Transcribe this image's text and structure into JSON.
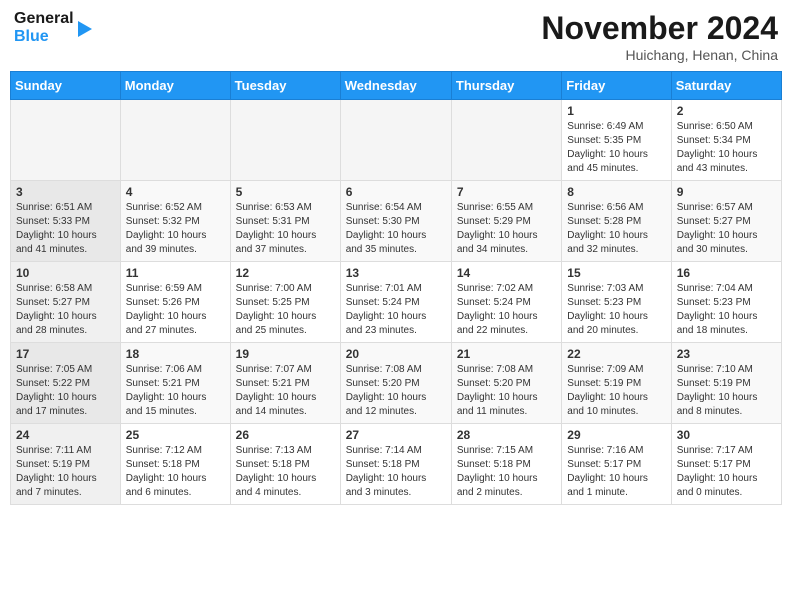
{
  "header": {
    "logo": {
      "general": "General",
      "blue": "Blue",
      "aria": "GeneralBlue logo"
    },
    "title": "November 2024",
    "location": "Huichang, Henan, China"
  },
  "calendar": {
    "days_of_week": [
      "Sunday",
      "Monday",
      "Tuesday",
      "Wednesday",
      "Thursday",
      "Friday",
      "Saturday"
    ],
    "weeks": [
      {
        "days": [
          {
            "num": "",
            "info": ""
          },
          {
            "num": "",
            "info": ""
          },
          {
            "num": "",
            "info": ""
          },
          {
            "num": "",
            "info": ""
          },
          {
            "num": "",
            "info": ""
          },
          {
            "num": "1",
            "info": "Sunrise: 6:49 AM\nSunset: 5:35 PM\nDaylight: 10 hours\nand 45 minutes."
          },
          {
            "num": "2",
            "info": "Sunrise: 6:50 AM\nSunset: 5:34 PM\nDaylight: 10 hours\nand 43 minutes."
          }
        ]
      },
      {
        "days": [
          {
            "num": "3",
            "info": "Sunrise: 6:51 AM\nSunset: 5:33 PM\nDaylight: 10 hours\nand 41 minutes."
          },
          {
            "num": "4",
            "info": "Sunrise: 6:52 AM\nSunset: 5:32 PM\nDaylight: 10 hours\nand 39 minutes."
          },
          {
            "num": "5",
            "info": "Sunrise: 6:53 AM\nSunset: 5:31 PM\nDaylight: 10 hours\nand 37 minutes."
          },
          {
            "num": "6",
            "info": "Sunrise: 6:54 AM\nSunset: 5:30 PM\nDaylight: 10 hours\nand 35 minutes."
          },
          {
            "num": "7",
            "info": "Sunrise: 6:55 AM\nSunset: 5:29 PM\nDaylight: 10 hours\nand 34 minutes."
          },
          {
            "num": "8",
            "info": "Sunrise: 6:56 AM\nSunset: 5:28 PM\nDaylight: 10 hours\nand 32 minutes."
          },
          {
            "num": "9",
            "info": "Sunrise: 6:57 AM\nSunset: 5:27 PM\nDaylight: 10 hours\nand 30 minutes."
          }
        ]
      },
      {
        "days": [
          {
            "num": "10",
            "info": "Sunrise: 6:58 AM\nSunset: 5:27 PM\nDaylight: 10 hours\nand 28 minutes."
          },
          {
            "num": "11",
            "info": "Sunrise: 6:59 AM\nSunset: 5:26 PM\nDaylight: 10 hours\nand 27 minutes."
          },
          {
            "num": "12",
            "info": "Sunrise: 7:00 AM\nSunset: 5:25 PM\nDaylight: 10 hours\nand 25 minutes."
          },
          {
            "num": "13",
            "info": "Sunrise: 7:01 AM\nSunset: 5:24 PM\nDaylight: 10 hours\nand 23 minutes."
          },
          {
            "num": "14",
            "info": "Sunrise: 7:02 AM\nSunset: 5:24 PM\nDaylight: 10 hours\nand 22 minutes."
          },
          {
            "num": "15",
            "info": "Sunrise: 7:03 AM\nSunset: 5:23 PM\nDaylight: 10 hours\nand 20 minutes."
          },
          {
            "num": "16",
            "info": "Sunrise: 7:04 AM\nSunset: 5:23 PM\nDaylight: 10 hours\nand 18 minutes."
          }
        ]
      },
      {
        "days": [
          {
            "num": "17",
            "info": "Sunrise: 7:05 AM\nSunset: 5:22 PM\nDaylight: 10 hours\nand 17 minutes."
          },
          {
            "num": "18",
            "info": "Sunrise: 7:06 AM\nSunset: 5:21 PM\nDaylight: 10 hours\nand 15 minutes."
          },
          {
            "num": "19",
            "info": "Sunrise: 7:07 AM\nSunset: 5:21 PM\nDaylight: 10 hours\nand 14 minutes."
          },
          {
            "num": "20",
            "info": "Sunrise: 7:08 AM\nSunset: 5:20 PM\nDaylight: 10 hours\nand 12 minutes."
          },
          {
            "num": "21",
            "info": "Sunrise: 7:08 AM\nSunset: 5:20 PM\nDaylight: 10 hours\nand 11 minutes."
          },
          {
            "num": "22",
            "info": "Sunrise: 7:09 AM\nSunset: 5:19 PM\nDaylight: 10 hours\nand 10 minutes."
          },
          {
            "num": "23",
            "info": "Sunrise: 7:10 AM\nSunset: 5:19 PM\nDaylight: 10 hours\nand 8 minutes."
          }
        ]
      },
      {
        "days": [
          {
            "num": "24",
            "info": "Sunrise: 7:11 AM\nSunset: 5:19 PM\nDaylight: 10 hours\nand 7 minutes."
          },
          {
            "num": "25",
            "info": "Sunrise: 7:12 AM\nSunset: 5:18 PM\nDaylight: 10 hours\nand 6 minutes."
          },
          {
            "num": "26",
            "info": "Sunrise: 7:13 AM\nSunset: 5:18 PM\nDaylight: 10 hours\nand 4 minutes."
          },
          {
            "num": "27",
            "info": "Sunrise: 7:14 AM\nSunset: 5:18 PM\nDaylight: 10 hours\nand 3 minutes."
          },
          {
            "num": "28",
            "info": "Sunrise: 7:15 AM\nSunset: 5:18 PM\nDaylight: 10 hours\nand 2 minutes."
          },
          {
            "num": "29",
            "info": "Sunrise: 7:16 AM\nSunset: 5:17 PM\nDaylight: 10 hours\nand 1 minute."
          },
          {
            "num": "30",
            "info": "Sunrise: 7:17 AM\nSunset: 5:17 PM\nDaylight: 10 hours\nand 0 minutes."
          }
        ]
      }
    ]
  }
}
